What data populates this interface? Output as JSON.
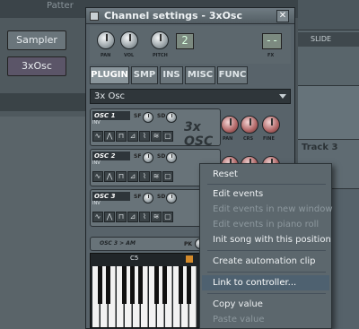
{
  "background": {
    "pattern_label": "Patter",
    "channels": [
      {
        "label": "Sampler"
      },
      {
        "label": "3xOsc"
      }
    ],
    "right_panel": {
      "slide_label": "SLIDE",
      "track_label": "Track 3"
    }
  },
  "window": {
    "title": "Channel settings - 3xOsc",
    "close_glyph": "✕",
    "knob_labels": [
      "PAN",
      "VOL",
      "PITCH"
    ],
    "fx_label": "FX",
    "pitch_display": "2",
    "fx_display": "--",
    "tabs": [
      "PLUGIN",
      "SMP",
      "INS",
      "MISC",
      "FUNC"
    ],
    "active_tab": "PLUGIN",
    "preset_name": "3x Osc",
    "oscillators": [
      {
        "name": "OSC 1",
        "inv": "INV",
        "sf": "SF",
        "sd": "SD"
      },
      {
        "name": "OSC 2",
        "inv": "INV",
        "sf": "SF",
        "sd": "SD"
      },
      {
        "name": "OSC 3",
        "inv": "INV",
        "sf": "SF",
        "sd": "SD"
      }
    ],
    "osc_logo": "3x OSC",
    "osc_knob_labels": [
      "PAN",
      "CRS",
      "FINE"
    ],
    "arp_label": "OSC 3 > AM",
    "arp_knob_label": "PK",
    "keyboard_marker": "C5"
  },
  "context_menu": {
    "items": [
      {
        "label": "Reset",
        "enabled": true
      },
      {
        "label": "Edit events",
        "enabled": true
      },
      {
        "label": "Edit events in new window",
        "enabled": false
      },
      {
        "label": "Edit events in piano roll",
        "enabled": false
      },
      {
        "label": "Init song with this position",
        "enabled": true
      },
      {
        "label": "Create automation clip",
        "enabled": true
      },
      {
        "label": "Link to controller...",
        "enabled": true,
        "highlighted": true
      },
      {
        "label": "Copy value",
        "enabled": true
      },
      {
        "label": "Paste value",
        "enabled": false
      }
    ]
  }
}
